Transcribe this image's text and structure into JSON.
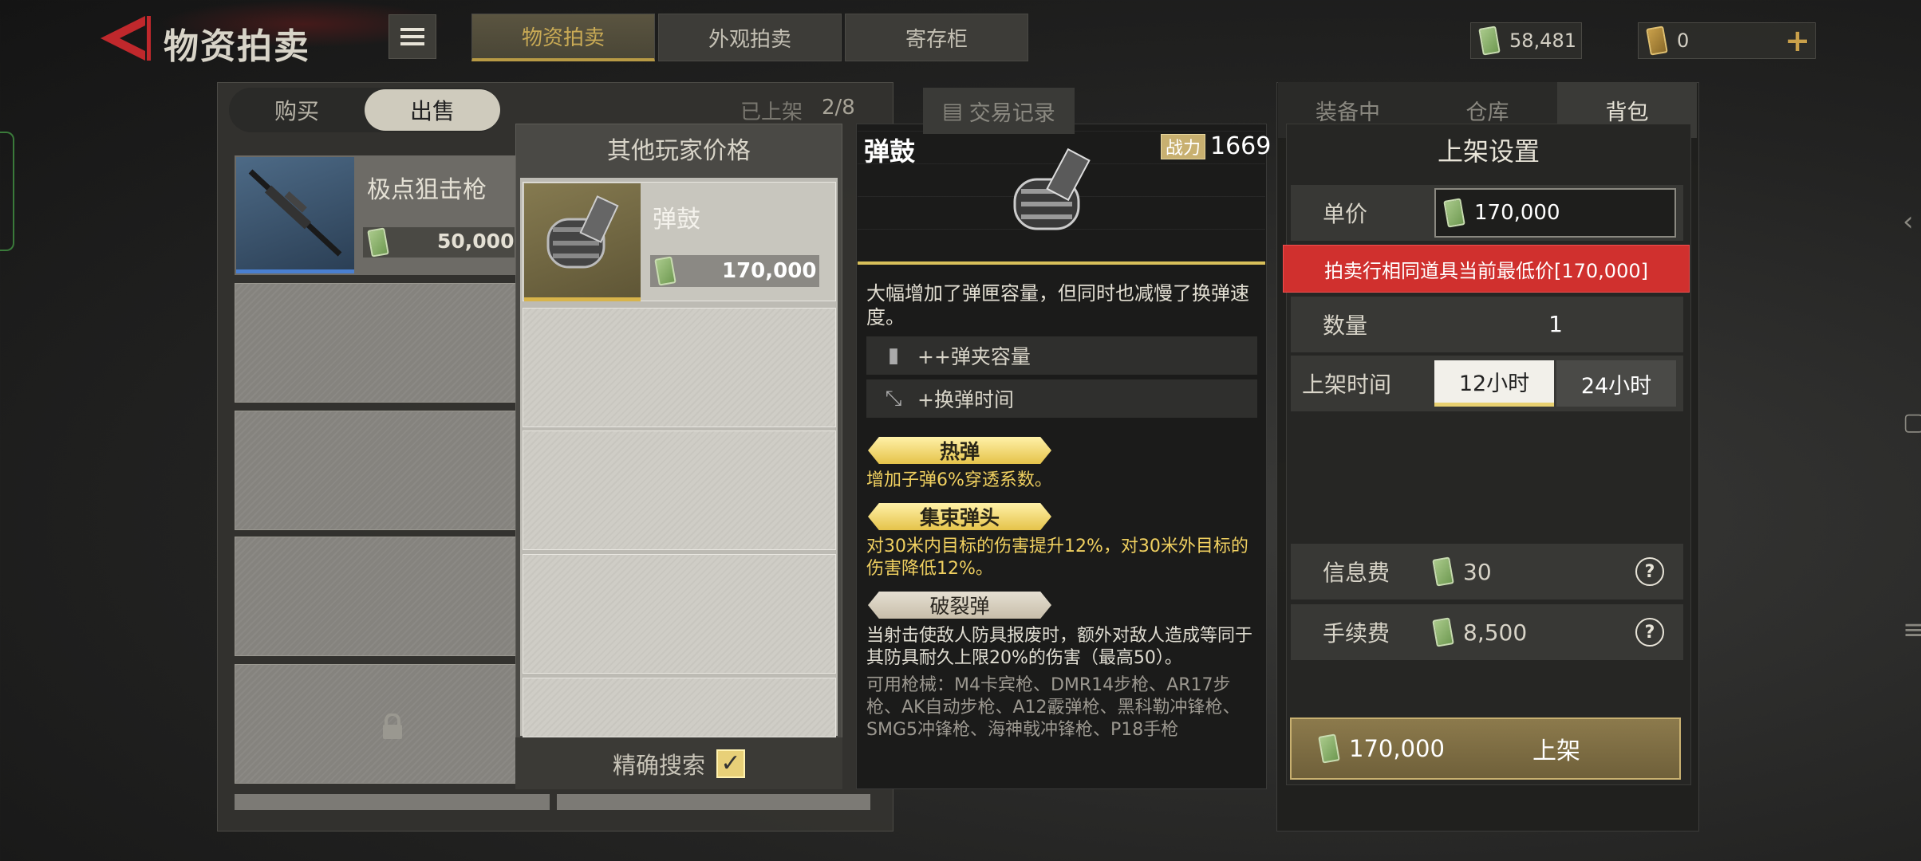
{
  "header": {
    "title": "物资拍卖",
    "tabs": [
      {
        "label": "物资拍卖",
        "active": true
      },
      {
        "label": "外观拍卖"
      },
      {
        "label": "寄存柜"
      }
    ],
    "currency": {
      "cash": "58,481",
      "tickets": "0"
    }
  },
  "left": {
    "segments": [
      "购买",
      "出售"
    ],
    "listed_label": "已上架",
    "listed_count": "2/8",
    "item": {
      "name": "极点狙击枪",
      "price": "50,000"
    }
  },
  "other_prices": {
    "title": "其他玩家价格",
    "entry": {
      "name": "弹鼓",
      "price": "170,000"
    },
    "exact_search": "精确搜索",
    "exact_checked": true
  },
  "detail": {
    "name": "弹鼓",
    "power_label": "战力",
    "power": "1669",
    "description": "大幅增加了弹匣容量，但同时也减慢了换弹速度。",
    "stats": [
      "++弹夹容量",
      "+换弹时间"
    ],
    "traits": [
      {
        "name": "热弹",
        "text": "增加子弹6%穿透系数。",
        "style": "gold"
      },
      {
        "name": "集束弹头",
        "text": "对30米内目标的伤害提升12%，对30米外目标的伤害降低12%。",
        "style": "gold"
      },
      {
        "name": "破裂弹",
        "text": "当射击使敌人防具报废时，额外对敌人造成等同于其防具耐久上限20%的伤害（最高50）。",
        "style": "gray"
      }
    ],
    "compatible": "可用枪械：M4卡宾枪、DMR14步枪、AR17步枪、AK自动步枪、A12霰弹枪、黑科勒冲锋枪、SMG5冲锋枪、海神戟冲锋枪、P18手枪"
  },
  "right": {
    "tabs": [
      {
        "label": "装备中"
      },
      {
        "label": "仓库"
      },
      {
        "label": "背包",
        "active": true
      }
    ],
    "trade_record": "交易记录",
    "listing": {
      "title": "上架设置",
      "unit_price_label": "单价",
      "unit_price": "170,000",
      "warning": "拍卖行相同道具当前最低价[170,000]",
      "qty_label": "数量",
      "qty": "1",
      "time_label": "上架时间",
      "time_options": [
        "12小时",
        "24小时"
      ],
      "info_fee_label": "信息费",
      "info_fee": "30",
      "fee_label": "手续费",
      "fee": "8,500",
      "submit_price": "170,000",
      "submit_label": "上架"
    }
  },
  "colors": {
    "accent_gold": "#c9aa55",
    "warning_red": "#d0302e",
    "panel_dark": "#262624"
  }
}
